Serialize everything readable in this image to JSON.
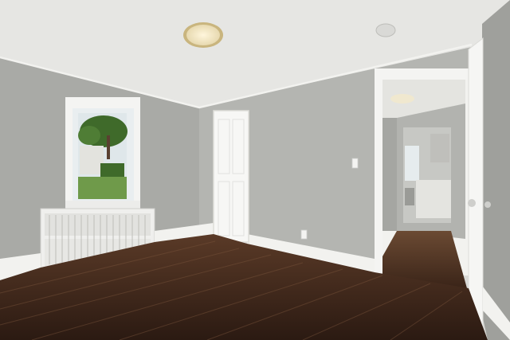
{
  "scene": {
    "subject": "empty room",
    "palette": {
      "ceiling": "#e6e6e3",
      "wall_left": "#a9aaa6",
      "wall_back": "#b6b7b3",
      "wall_right": "#9fa09c",
      "trim": "#f4f4f2",
      "floor_dark": "#2e1d14",
      "floor_mid": "#4a3020",
      "floor_light": "#6b4a33",
      "window_sky": "#e9eef0",
      "lawn": "#6f9a4a",
      "foliage": "#3f6a2a"
    },
    "elements": [
      "ceiling-light-icon",
      "smoke-detector-icon",
      "window",
      "radiator",
      "closet-door",
      "light-switch-icon",
      "outlet-icon",
      "hallway-doorway",
      "open-door",
      "hardwood-floor"
    ]
  }
}
